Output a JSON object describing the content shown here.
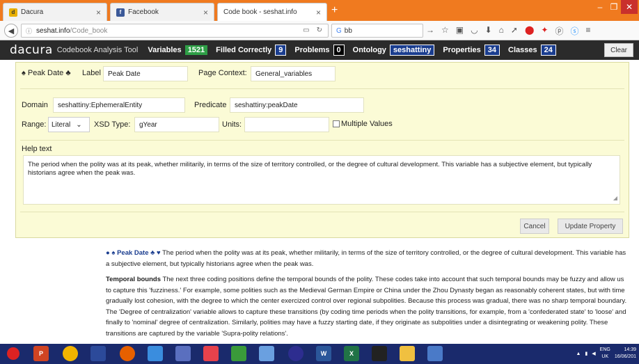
{
  "browser": {
    "tabs": [
      {
        "label": "Dacura",
        "favicon": "dacura-favicon-icon",
        "close": "×"
      },
      {
        "label": "Facebook",
        "favicon": "facebook-favicon-icon",
        "close": "×"
      },
      {
        "label": "Code book - seshat.info",
        "favicon": "",
        "close": "×"
      }
    ],
    "new_tab": "+",
    "window_controls": [
      "–",
      "❐",
      "✕"
    ],
    "url_domain": "seshat.info",
    "url_path": "/Code_book",
    "search_value": "bb"
  },
  "dacura": {
    "logo": "dacura",
    "app_title": "Codebook Analysis Tool",
    "stats": [
      {
        "label": "Variables",
        "value": "1521",
        "color": "#2e9e46"
      },
      {
        "label": "Filled Correctly",
        "value": "9",
        "color": "#1a3d8f"
      },
      {
        "label": "Problems",
        "value": "0",
        "color": "#000000"
      },
      {
        "label": "Ontology",
        "value": "seshattiny",
        "color": "#1a3d8f"
      },
      {
        "label": "Properties",
        "value": "34",
        "color": "#1a3d8f"
      },
      {
        "label": "Classes",
        "value": "24",
        "color": "#1a3d8f"
      }
    ],
    "clear_label": "Clear"
  },
  "editor": {
    "variable_title": "♠ Peak Date ♣",
    "label_label": "Label",
    "label_value": "Peak Date",
    "page_context_label": "Page Context:",
    "page_context_value": "General_variables",
    "domain_label": "Domain",
    "domain_value": "seshattiny:EphemeralEntity",
    "predicate_label": "Predicate",
    "predicate_value": "seshattiny:peakDate",
    "range_label": "Range:",
    "range_value": "Literal",
    "xsd_label": "XSD Type:",
    "xsd_value": "gYear",
    "units_label": "Units:",
    "units_value": "",
    "multiple_values_label": "Multiple Values",
    "help_label": "Help text",
    "help_value": "The period when the polity was at its peak, whether militarily, in terms of the size of territory controlled, or the degree of cultural development. This variable has a subjective element, but typically historians agree when the peak was.",
    "cancel_label": "Cancel",
    "update_label": "Update Property"
  },
  "content": {
    "peak_bullet": "●",
    "peak_name": "♠ Peak Date ♣ ♥",
    "peak_text": "The period when the polity was at its peak, whether militarily, in terms of the size of territory controlled, or the degree of cultural development. This variable has a subjective element, but typically historians agree when the peak was.",
    "temporal_heading": "Temporal bounds",
    "temporal_text": "The next three coding positions define the temporal bounds of the polity. These codes take into account that such temporal bounds may be fuzzy and allow us to capture this 'fuzziness.' For example, some polities such as the Medieval German Empire or China under the Zhou Dynasty began as reasonably coherent states, but with time gradually lost cohesion, with the degree to which the center exercized control over regional subpolities. Because this process was gradual, there was no sharp temporal boundary. The 'Degree of centralization' variable allows to capture these transitions (by coding time periods when the polity transitions, for example, from a 'confederated state' to 'loose' and finally to 'nominal' degree of centralization. Similarly, polities may have a fuzzy starting date, if they originate as subpolities under a disintegrating or weakening polity. These transitions are captured by the variable 'Supra-polity relations'."
  },
  "taskbar": {
    "lang_top": "ENG",
    "lang_bottom": "UK",
    "time": "14:39",
    "date": "16/06/201"
  }
}
